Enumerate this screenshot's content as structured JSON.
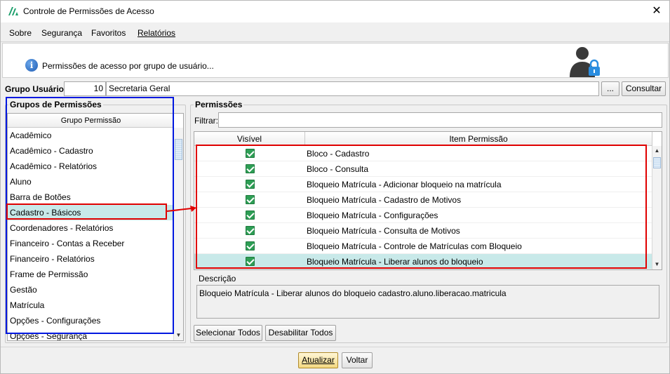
{
  "window": {
    "title": "Controle de Permissões de Acesso",
    "close_glyph": "✕"
  },
  "menu": [
    {
      "label": "Sobre"
    },
    {
      "label": "Segurança"
    },
    {
      "label": "Favoritos"
    },
    {
      "label": "Relatórios"
    }
  ],
  "header": {
    "info_text": "Permissões de acesso por grupo de usuário...",
    "info_glyph": "i",
    "icon": "user-lock-icon"
  },
  "grupo_usuario": {
    "label": "Grupo Usuário:",
    "code": "10",
    "name": "Secretaria Geral",
    "browse_label": "...",
    "consultar_label": "Consultar"
  },
  "grupos": {
    "title": "Grupos de Permissões",
    "column_header": "Grupo Permissão",
    "items": [
      "Acadêmico",
      "Acadêmico - Cadastro",
      "Acadêmico - Relatórios",
      "Aluno",
      "Barra de Botões",
      "Cadastro - Básicos",
      "Coordenadores - Relatórios",
      "Financeiro - Contas a Receber",
      "Financeiro - Relatórios",
      "Frame de Permissão",
      "Gestão",
      "Matrícula",
      "Opções - Configurações",
      "Opções - Segurança"
    ],
    "selected_index": 5
  },
  "permissoes": {
    "title": "Permissões",
    "filter_label": "Filtrar:",
    "filter_value": "",
    "col_visivel": "Visível",
    "col_item": "Item Permissão",
    "rows": [
      {
        "visivel": true,
        "item": "Bloco - Cadastro"
      },
      {
        "visivel": true,
        "item": "Bloco - Consulta"
      },
      {
        "visivel": true,
        "item": "Bloqueio Matrícula - Adicionar bloqueio na matrícula"
      },
      {
        "visivel": true,
        "item": "Bloqueio Matrícula - Cadastro de Motivos"
      },
      {
        "visivel": true,
        "item": "Bloqueio Matrícula - Configurações"
      },
      {
        "visivel": true,
        "item": "Bloqueio Matrícula - Consulta de Motivos"
      },
      {
        "visivel": true,
        "item": "Bloqueio Matrícula - Controle de Matrículas com Bloqueio"
      },
      {
        "visivel": true,
        "item": "Bloqueio Matrícula - Liberar alunos do bloqueio"
      }
    ],
    "selected_index": 7
  },
  "descricao": {
    "title": "Descrição",
    "text": "Bloqueio Matrícula - Liberar alunos do bloqueio cadastro.aluno.liberacao.matricula"
  },
  "buttons": {
    "selecionar_todos": "Selecionar Todos",
    "desabilitar_todos": "Desabilitar Todos",
    "atualizar": "Atualizar",
    "voltar": "Voltar"
  },
  "colors": {
    "selection": "#c8e9e9",
    "annotation_blue": "#0018e0",
    "annotation_red": "#e00000",
    "check_green": "#2e9e55"
  }
}
